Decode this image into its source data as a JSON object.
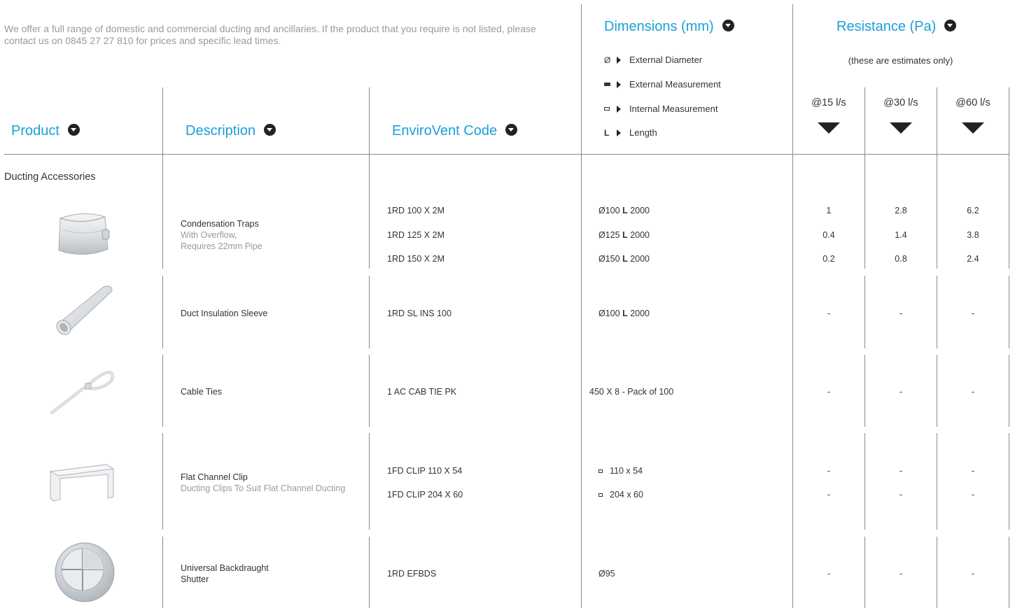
{
  "intro": "We offer a full range of domestic and commercial ducting and ancillaries. If the product that you require is not listed, please contact us on 0845 27 27 810 for prices and specific lead times.",
  "headers": {
    "product": "Product",
    "description": "Description",
    "code": "EnviroVent Code",
    "dimensions": "Dimensions (mm)",
    "resistance": "Resistance (Pa)"
  },
  "dimension_legend": {
    "external_diameter": {
      "symbol": "Ø",
      "label": "External Diameter"
    },
    "external_measurement": {
      "label": "External Measurement"
    },
    "internal_measurement": {
      "label": "Internal Measurement"
    },
    "length": {
      "symbol": "L",
      "label": "Length"
    }
  },
  "resistance_note": "(these are estimates only)",
  "flow_rates": [
    "@15 l/s",
    "@30 l/s",
    "@60 l/s"
  ],
  "section_title": "Ducting Accessories",
  "products": [
    {
      "name": "Condensation Traps",
      "sub1": "With Overflow,",
      "sub2": "Requires 22mm Pipe",
      "rows": [
        {
          "code": "1RD 100 X 2M",
          "dim": "Ø100",
          "len_sym": "L",
          "len": "2000",
          "r15": "1",
          "r30": "2.8",
          "r60": "6.2"
        },
        {
          "code": "1RD 125 X 2M",
          "dim": "Ø125",
          "len_sym": "L",
          "len": "2000",
          "r15": "0.4",
          "r30": "1.4",
          "r60": "3.8"
        },
        {
          "code": "1RD 150 X 2M",
          "dim": "Ø150",
          "len_sym": "L",
          "len": "2000",
          "r15": "0.2",
          "r30": "0.8",
          "r60": "2.4"
        }
      ]
    },
    {
      "name": "Duct Insulation Sleeve",
      "rows": [
        {
          "code": "1RD SL INS 100",
          "dim": "Ø100",
          "len_sym": "L",
          "len": "2000",
          "r15": "-",
          "r30": "-",
          "r60": "-"
        }
      ]
    },
    {
      "name": "Cable Ties",
      "rows": [
        {
          "code": "1 AC CAB TIE PK",
          "dim": "450 X 8 - Pack of 100",
          "r15": "-",
          "r30": "-",
          "r60": "-"
        }
      ]
    },
    {
      "name": "Flat Channel Clip",
      "sub1": "Ducting Clips To Suit Flat Channel Ducting",
      "rows": [
        {
          "code": "1FD CLIP 110 X 54",
          "dim": "110 x 54",
          "r15": "-",
          "r30": "-",
          "r60": "-"
        },
        {
          "code": "1FD CLIP 204 X 60",
          "dim": "204 x 60",
          "r15": "-",
          "r30": "-",
          "r60": "-"
        }
      ]
    },
    {
      "name": "Universal Backdraught",
      "name2": "Shutter",
      "rows": [
        {
          "code": "1RD EFBDS",
          "dim": "Ø95",
          "r15": "-",
          "r30": "-",
          "r60": "-"
        }
      ]
    }
  ]
}
